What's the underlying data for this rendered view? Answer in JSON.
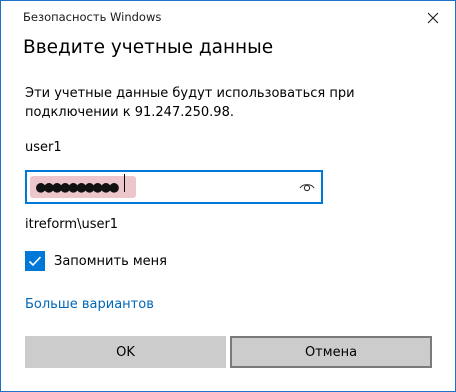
{
  "window": {
    "title": "Безопасность Windows"
  },
  "dialog": {
    "heading": "Введите учетные данные",
    "description": "Эти учетные данные будут использоваться при подключении к 91.247.250.98.",
    "username": "user1",
    "password_masked": "●●●●●●●●●●",
    "domain_user": "itreform\\user1",
    "remember_label": "Запомнить меня",
    "remember_checked": true,
    "more_options": "Больше вариантов"
  },
  "buttons": {
    "ok": "OK",
    "cancel": "Отмена"
  },
  "icons": {
    "close": "close-icon",
    "reveal_password": "eye-icon",
    "checkmark": "checkmark-icon"
  },
  "colors": {
    "accent": "#0078d7",
    "link": "#0067b8",
    "button_bg": "#cccccc",
    "password_highlight": "#ecc6cb"
  }
}
